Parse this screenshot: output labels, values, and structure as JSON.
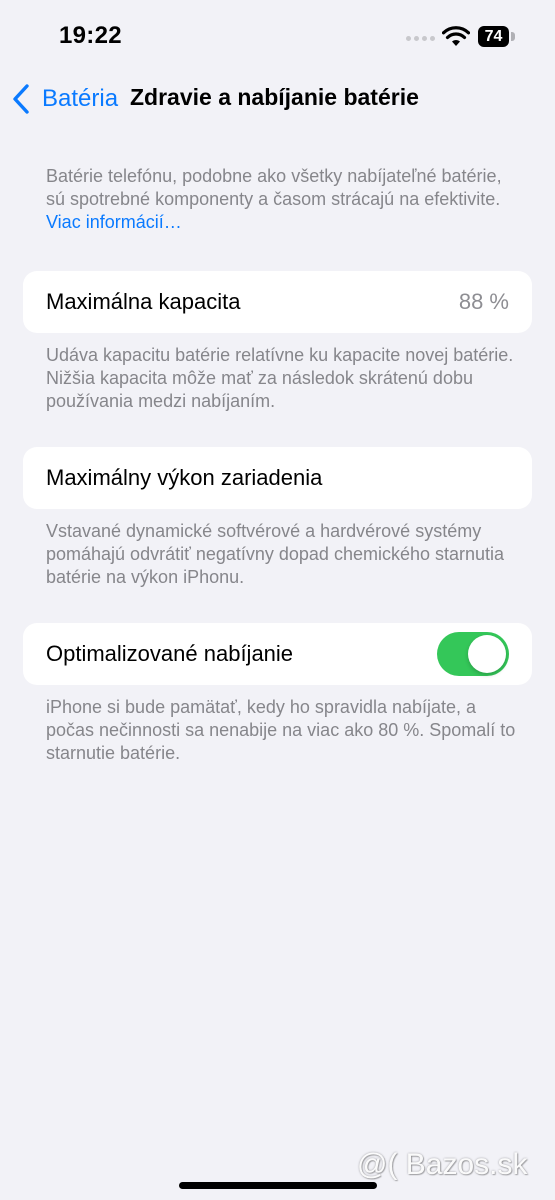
{
  "status_bar": {
    "time": "19:22",
    "battery_level": "74",
    "icons": [
      "cellular-dots-icon",
      "wifi-icon",
      "battery-icon"
    ]
  },
  "nav": {
    "back_label": "Batéria",
    "back_icon": "chevron-left-icon",
    "title": "Zdravie a nabíjanie batérie"
  },
  "intro": {
    "text": "Batérie telefónu, podobne ako všetky nabíjateľné batérie, sú spotrebné komponenty a časom strácajú na efektivite.",
    "link": "Viac informácií…"
  },
  "max_capacity": {
    "label": "Maximálna kapacita",
    "value": "88 %",
    "footer": "Udáva kapacitu batérie relatívne ku kapacite novej batérie. Nižšia kapacita môže mať za následok skrátenú dobu používania medzi nabíjaním."
  },
  "peak_performance": {
    "label": "Maximálny výkon zariadenia",
    "footer": "Vstavané dynamické softvérové a hardvérové systémy pomáhajú odvrátiť negatívny dopad chemického starnutia batérie na výkon iPhonu."
  },
  "optimized_charging": {
    "label": "Optimalizované nabíjanie",
    "enabled": true,
    "footer": "iPhone si bude pamätať, kedy ho spravidla nabíjate, a počas nečinnosti sa nenabije na viac ako 80 %. Spomalí to starnutie batérie."
  },
  "watermark": "@( Bazos.sk",
  "colors": {
    "background": "#f2f2f7",
    "accent": "#0a7aff",
    "toggle_on": "#34c759",
    "secondary_text": "#86868b"
  }
}
